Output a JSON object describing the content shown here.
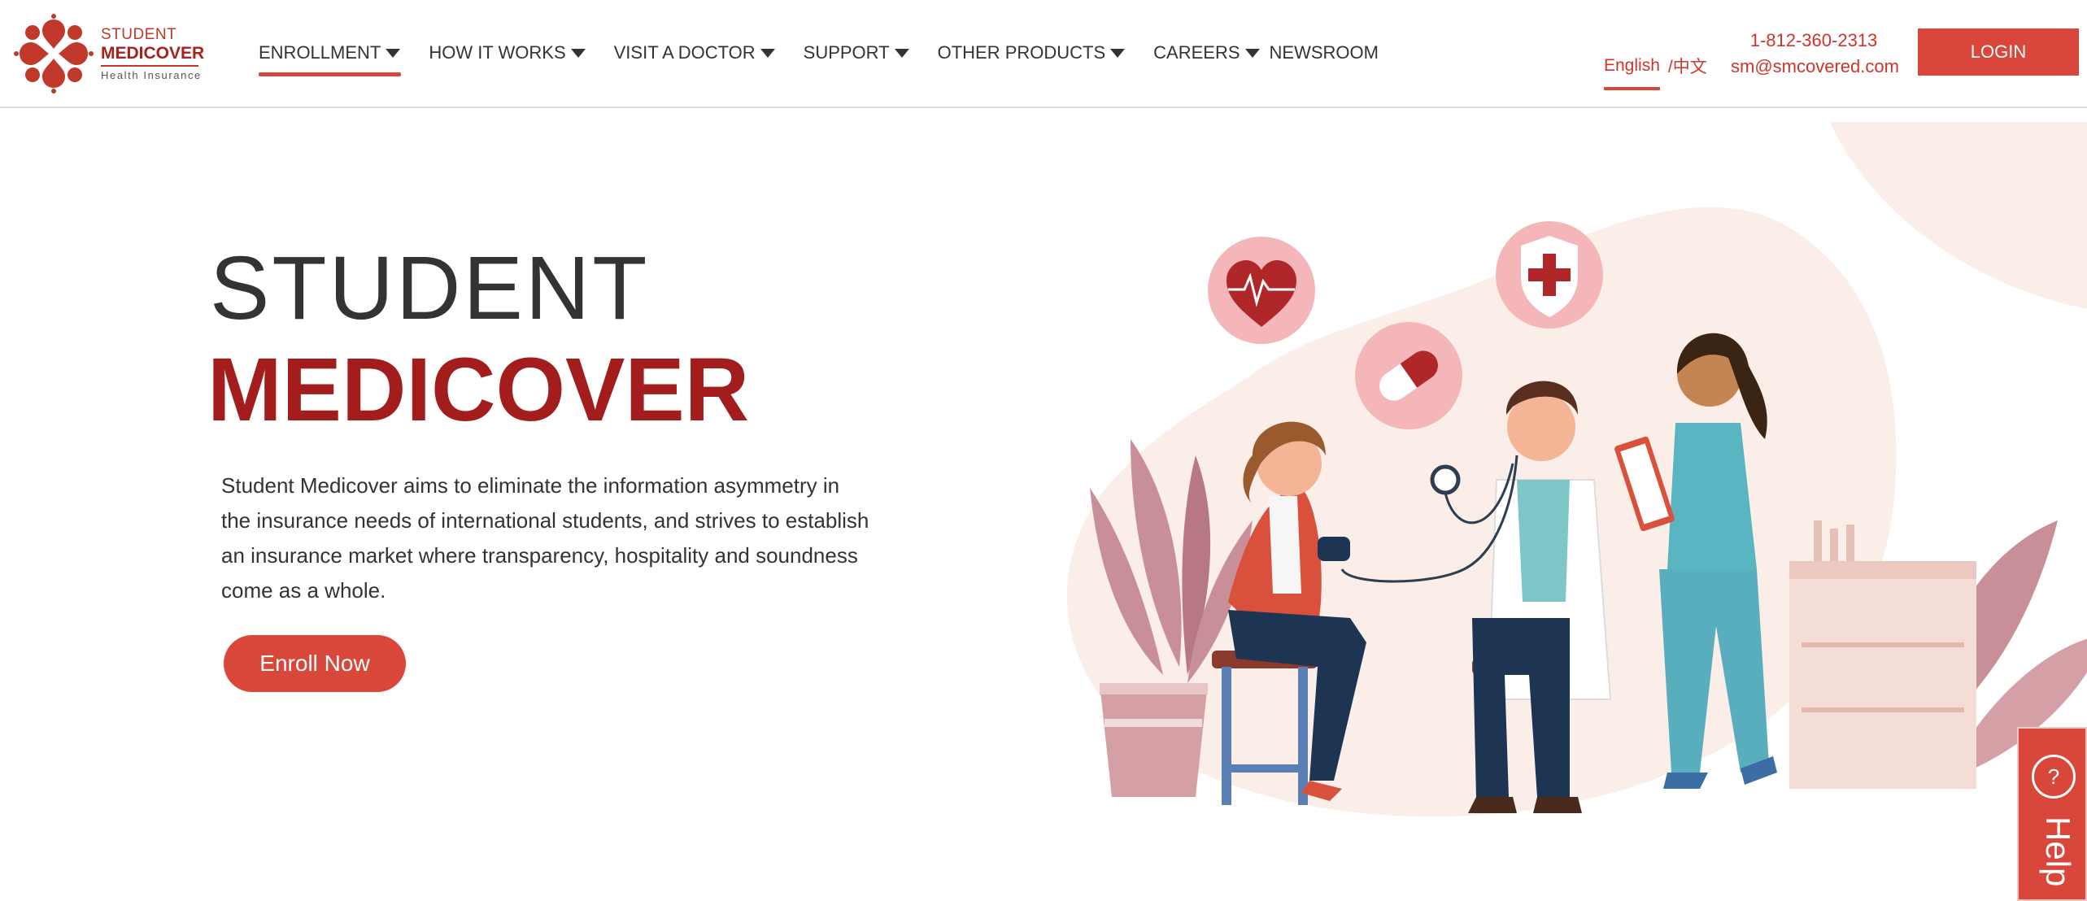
{
  "logo": {
    "line1": "STUDENT",
    "line2": "MEDICOVER",
    "line3": "Health Insurance"
  },
  "nav": {
    "items": [
      {
        "label": "ENROLLMENT",
        "dropdown": true,
        "active": true
      },
      {
        "label": "HOW IT WORKS",
        "dropdown": true
      },
      {
        "label": "VISIT A DOCTOR",
        "dropdown": true
      },
      {
        "label": "SUPPORT",
        "dropdown": true
      },
      {
        "label": "OTHER PRODUCTS",
        "dropdown": true
      },
      {
        "label": "CAREERS",
        "dropdown": true
      },
      {
        "label": "NEWSROOM",
        "dropdown": false
      }
    ]
  },
  "language": {
    "english": "English",
    "chinese": "/中文"
  },
  "contact": {
    "phone": "1-812-360-2313",
    "email": "sm@smcovered.com"
  },
  "login_label": "LOGIN",
  "hero": {
    "title_line1": "STUDENT",
    "title_line2": "MEDICOVER",
    "description": "Student Medicover aims to eliminate the information asymmetry in the insurance needs of international students, and strives to establish an insurance market where transparency, hospitality and soundness come as a whole.",
    "cta_label": "Enroll Now"
  },
  "help_widget": {
    "label": "Help",
    "icon": "?"
  },
  "colors": {
    "brand_red": "#d9473a",
    "title_red": "#a41d1d",
    "text_dark": "#333333",
    "peach_bg": "#fbeee8"
  }
}
